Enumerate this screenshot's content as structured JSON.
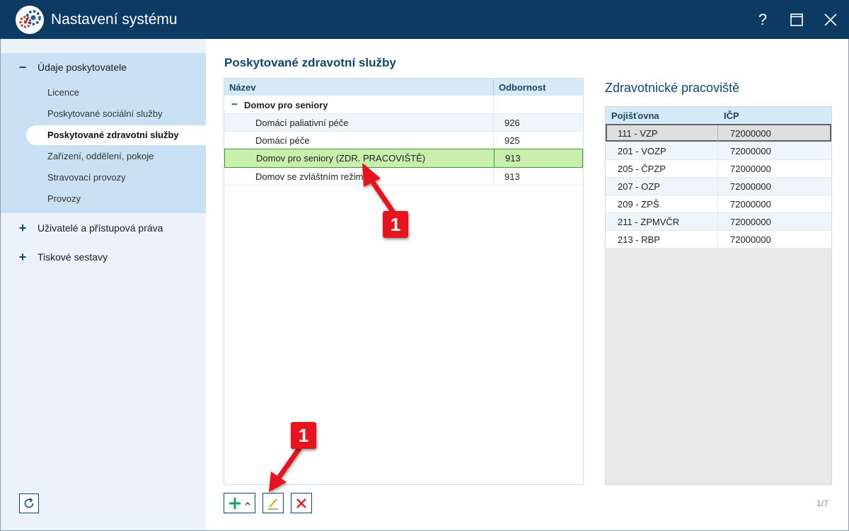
{
  "window": {
    "title": "Nastavení systému",
    "help_label": "?",
    "icons": {
      "logo": "gears-icon",
      "help": "help-icon",
      "maximize": "maximize-icon",
      "close": "close-icon"
    }
  },
  "sidebar": {
    "groups": [
      {
        "label": "Údaje poskytovatele",
        "expanded": true,
        "items": [
          {
            "label": "Licence"
          },
          {
            "label": "Poskytované sociální služby"
          },
          {
            "label": "Poskytované zdravotní služby",
            "active": true
          },
          {
            "label": "Zařízení, oddělení, pokoje"
          },
          {
            "label": "Stravovací provozy"
          },
          {
            "label": "Provozy"
          }
        ]
      },
      {
        "label": "Uživatelé a přístupová práva",
        "expanded": false
      },
      {
        "label": "Tiskové sestavy",
        "expanded": false
      }
    ],
    "refresh_icon": "refresh-icon"
  },
  "main": {
    "title": "Poskytované zdravotní služby",
    "services": {
      "columns": [
        "Název",
        "Odbornost"
      ],
      "group": "Domov pro seniory",
      "rows": [
        {
          "name": "Domácí paliativní péče",
          "code": "926"
        },
        {
          "name": "Domácí péče",
          "code": "925"
        },
        {
          "name": "Domov pro seniory (ZDR. PRACOVIŠTĚ)",
          "code": "913",
          "selected": true
        },
        {
          "name": "Domov se zvláštním režimem",
          "code": "913"
        }
      ]
    },
    "workplace": {
      "title": "Zdravotnické pracoviště",
      "columns": [
        "Pojišťovna",
        "IČP"
      ],
      "rows": [
        {
          "insurer": "111 - VZP",
          "icp": "72000000",
          "selected": true
        },
        {
          "insurer": "201 - VOZP",
          "icp": "72000000"
        },
        {
          "insurer": "205 - ČPZP",
          "icp": "72000000"
        },
        {
          "insurer": "207 - OZP",
          "icp": "72000000"
        },
        {
          "insurer": "209 - ZPŠ",
          "icp": "72000000"
        },
        {
          "insurer": "211 - ZPMVČR",
          "icp": "72000000"
        },
        {
          "insurer": "213 - RBP",
          "icp": "72000000"
        }
      ],
      "pager": "1/7"
    },
    "toolbar": {
      "add_icon": "plus-icon",
      "add_menu_icon": "caret-up-icon",
      "edit_icon": "pencil-icon",
      "delete_icon": "delete-x-icon"
    }
  },
  "annotations": {
    "callout_a": "1",
    "callout_b": "1",
    "color": "#e4151f"
  },
  "colors": {
    "titlebar": "#0d3a63",
    "accent": "#12466f",
    "sidebar_bg": "#eaf3fa",
    "sidebar_expanded": "#c9e2f3",
    "grid_header": "#d5e9f7",
    "selected_row": "#c8efae"
  }
}
